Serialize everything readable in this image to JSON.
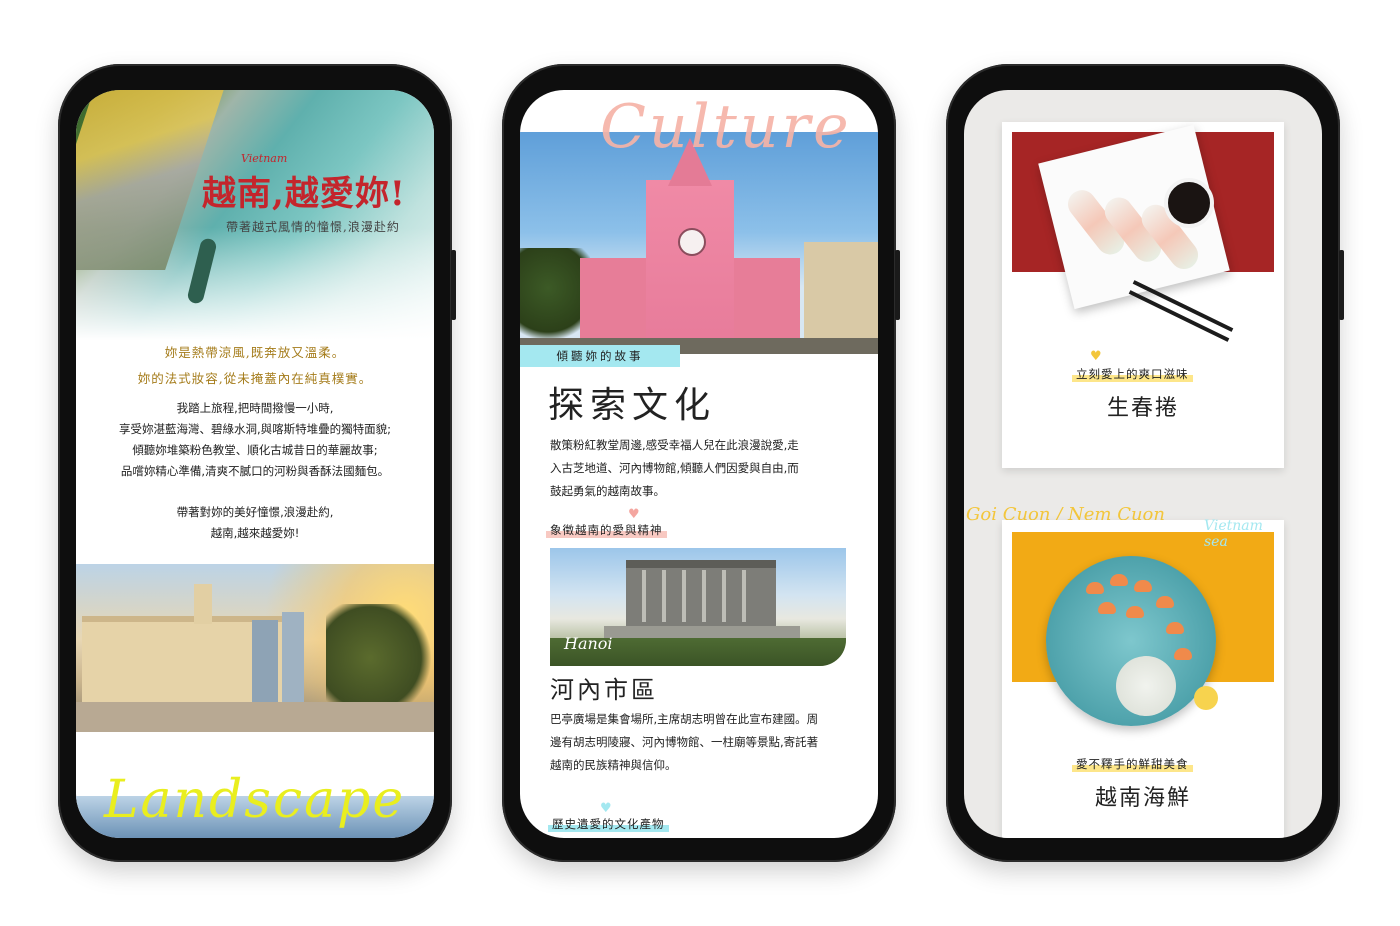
{
  "phone1": {
    "hero_viet": "Vietnam",
    "hero_title": "越南,越愛妳!",
    "hero_subtitle": "帶著越式風情的憧憬,浪漫赴約",
    "intro_lines": [
      "妳是熱帶涼風,既奔放又溫柔。",
      "妳的法式妝容,從未掩蓋內在純真樸實。"
    ],
    "body_lines": [
      "我踏上旅程,把時間撥慢一小時,",
      "享受妳湛藍海灣、碧綠水洞,與喀斯特堆疊的獨特面貌;",
      "傾聽妳堆築粉色教堂、順化古城昔日的華麗故事;",
      "品嚐妳精心準備,清爽不膩口的河粉與香酥法國麵包。"
    ],
    "closing_lines": [
      "帶著對妳的美好憧憬,浪漫赴約,",
      "越南,越來越愛妳!"
    ],
    "section_script": "Landscape"
  },
  "phone2": {
    "script_heading": "Culture",
    "badge": "傾聽妳的故事",
    "title": "探索文化",
    "para1_lines": [
      "散策粉紅教堂周邊,感受幸福人兒在此浪漫說愛,走",
      "入古芝地道、河內博物館,傾聽人們因愛與自由,而",
      "鼓起勇氣的越南故事。"
    ],
    "tag1": "象徵越南的愛與精神",
    "photo_label": "Hanoi",
    "subtitle": "河內市區",
    "para2_lines": [
      "巴亭廣場是集會場所,主席胡志明曾在此宣布建國。周",
      "邊有胡志明陵寢、河內博物館、一柱廟等景點,寄託著",
      "越南的民族精神與信仰。"
    ],
    "tag2": "歷史遺愛的文化產物",
    "accent_pink": "#f8c9c2",
    "accent_cyan": "#a4e8f0"
  },
  "phone3": {
    "card1_tag": "立刻愛上的爽口滋味",
    "card1_title": "生春捲",
    "script_food": "Goi Cuon / Nem Cuon",
    "script_sea": "Vietnam sea",
    "card2_tag": "愛不釋手的鮮甜美食",
    "card2_title": "越南海鮮",
    "accent_yellow": "#fde68a",
    "accent_red": "#a62525",
    "accent_orange": "#f2aa15"
  },
  "icons": [
    "heart-icon"
  ]
}
